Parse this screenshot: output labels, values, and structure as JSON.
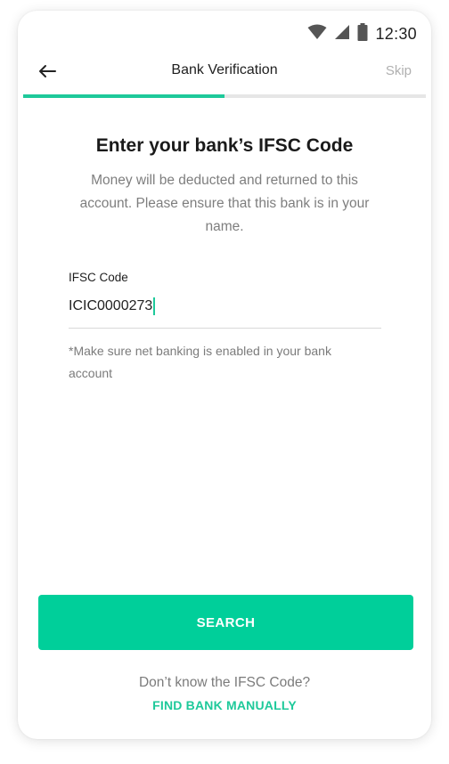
{
  "status_bar": {
    "time": "12:30",
    "icons": [
      "wifi-icon",
      "cellular-signal-icon",
      "battery-icon"
    ]
  },
  "app_bar": {
    "title": "Bank Verification",
    "skip_label": "Skip",
    "back_icon": "arrow-left-icon"
  },
  "progress": {
    "value": 0.5,
    "fill_color": "#1ec99a"
  },
  "content": {
    "heading": "Enter your bank’s IFSC Code",
    "subtitle": "Money will be deducted and returned to this account. Please ensure that this bank is in your name.",
    "field": {
      "label": "IFSC Code",
      "value": "ICIC0000273"
    },
    "note": "*Make sure net banking is enabled in your bank account"
  },
  "actions": {
    "search_label": "SEARCH",
    "dont_know_text": "Don’t know the IFSC Code?",
    "find_manually_label": "FIND BANK MANUALLY"
  },
  "colors": {
    "accent": "#00cf9a",
    "link": "#1ec99a"
  }
}
